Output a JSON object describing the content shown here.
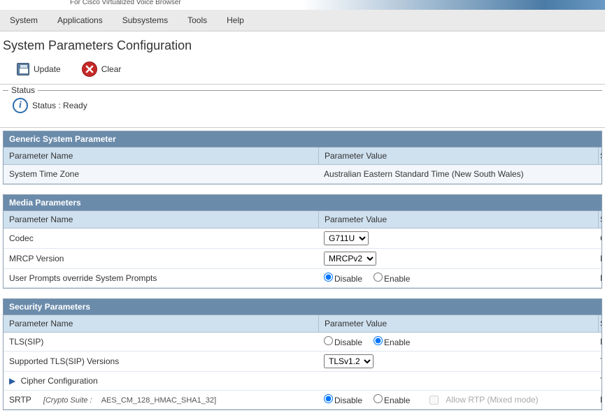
{
  "product_subtitle": "For Cisco Virtualized Voice Browser",
  "menubar": {
    "items": [
      {
        "label": "System"
      },
      {
        "label": "Applications"
      },
      {
        "label": "Subsystems"
      },
      {
        "label": "Tools"
      },
      {
        "label": "Help"
      }
    ]
  },
  "page_title": "System Parameters Configuration",
  "toolbar": {
    "update_label": "Update",
    "clear_label": "Clear"
  },
  "status": {
    "legend": "Status",
    "text": "Status : Ready"
  },
  "columns": {
    "name": "Parameter Name",
    "value": "Parameter Value",
    "third": "S"
  },
  "sections": {
    "generic": {
      "title": "Generic System Parameter",
      "timezone_label": "System Time Zone",
      "timezone_value": "Australian Eastern Standard Time (New South Wales)"
    },
    "media": {
      "title": "Media Parameters",
      "codec_label": "Codec",
      "codec_value": "G711U",
      "mrcp_label": "MRCP Version",
      "mrcp_value": "MRCPv2",
      "prompts_label": "User Prompts override System Prompts",
      "prompts_third": "D",
      "codec_third": "C",
      "mrcp_third": "M"
    },
    "security": {
      "title": "Security Parameters",
      "tls_label": "TLS(SIP)",
      "tls_third": "D",
      "supported_label": "Supported TLS(SIP) Versions",
      "supported_value": "TLSv1.2",
      "supported_third": "T",
      "cipher_label": "Cipher Configuration",
      "cipher_third": "T",
      "srtp_label": "SRTP",
      "srtp_crypto_prefix": "[Crypto Suite :",
      "srtp_crypto_value": "AES_CM_128_HMAC_SHA1_32]",
      "srtp_third": "D",
      "allow_rtp_label": "Allow RTP (Mixed mode)"
    }
  },
  "radio": {
    "disable": "Disable",
    "enable": "Enable"
  }
}
